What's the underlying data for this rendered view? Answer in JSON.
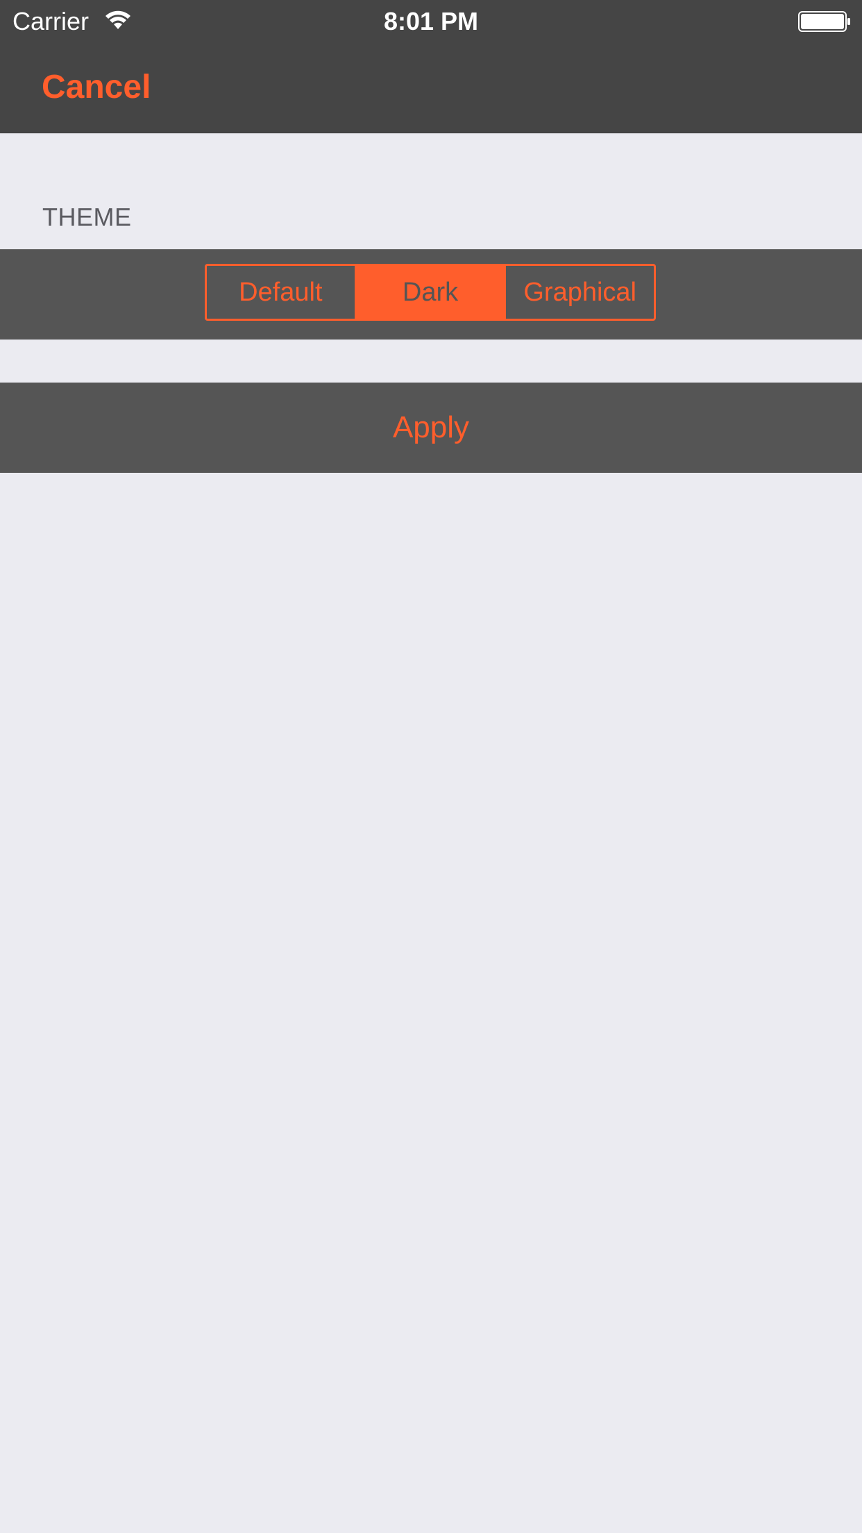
{
  "status_bar": {
    "carrier": "Carrier",
    "time": "8:01 PM",
    "wifi_icon": "wifi-icon",
    "battery_icon": "battery-icon"
  },
  "nav": {
    "cancel_label": "Cancel"
  },
  "theme_section": {
    "header": "THEME",
    "options": [
      "Default",
      "Dark",
      "Graphical"
    ],
    "selected": "Dark"
  },
  "apply_label": "Apply",
  "colors": {
    "accent": "#FF5E2C",
    "bar_background": "#454545",
    "cell_background": "#555555",
    "page_background": "#EBEBF1"
  }
}
